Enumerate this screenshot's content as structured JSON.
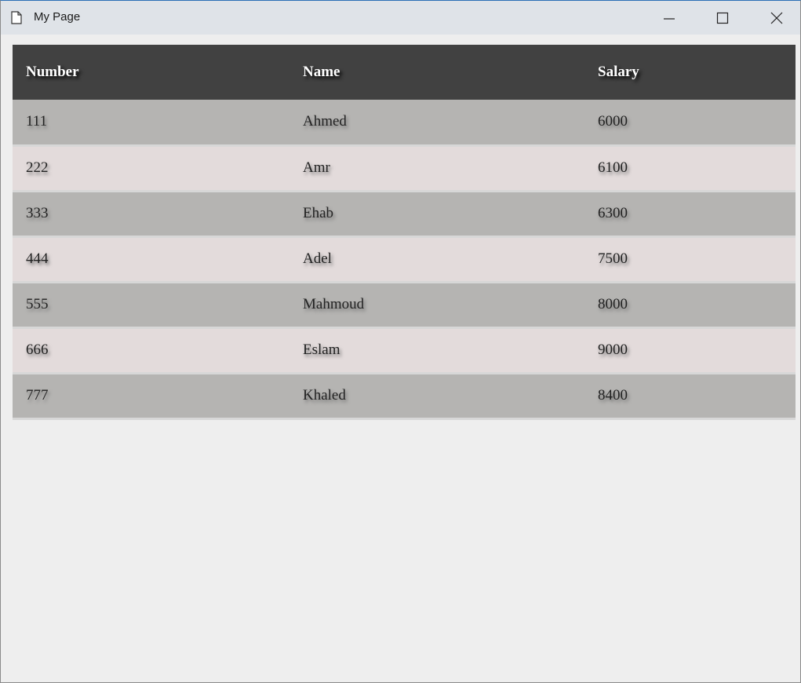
{
  "window": {
    "title": "My Page",
    "controls": {
      "minimize_icon": "minimize-icon",
      "maximize_icon": "maximize-icon",
      "close_icon": "close-icon"
    }
  },
  "table": {
    "headers": [
      "Number",
      "Name",
      "Salary"
    ],
    "rows": [
      [
        "111",
        "Ahmed",
        "6000"
      ],
      [
        "222",
        "Amr",
        "6100"
      ],
      [
        "333",
        "Ehab",
        "6300"
      ],
      [
        "444",
        "Adel",
        "7500"
      ],
      [
        "555",
        "Mahmoud",
        "8000"
      ],
      [
        "666",
        "Eslam",
        "9000"
      ],
      [
        "777",
        "Khaled",
        "8400"
      ]
    ]
  },
  "colors": {
    "header_bg": "#414141",
    "row_odd_bg": "#b5b4b2",
    "row_even_bg": "#e3dbdb",
    "page_bg": "#eeeeee",
    "titlebar_bg": "#dfe3e8"
  }
}
